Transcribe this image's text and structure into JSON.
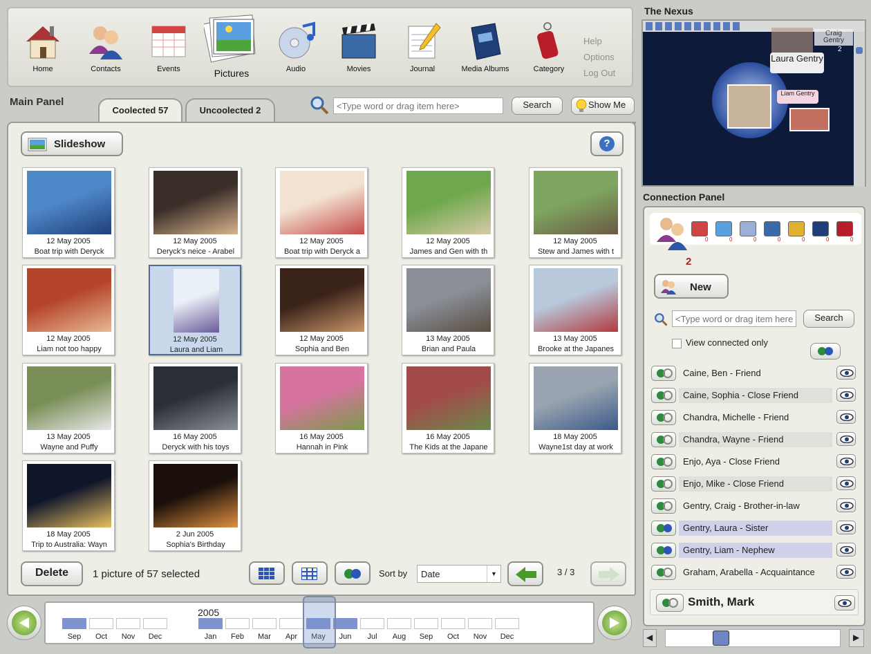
{
  "toolbar": {
    "items": [
      {
        "label": "Home",
        "icon": "home-icon"
      },
      {
        "label": "Contacts",
        "icon": "contacts-icon"
      },
      {
        "label": "Events",
        "icon": "calendar-icon"
      },
      {
        "label": "Pictures",
        "icon": "pictures-icon"
      },
      {
        "label": "Audio",
        "icon": "cd-icon"
      },
      {
        "label": "Movies",
        "icon": "clapperboard-icon"
      },
      {
        "label": "Journal",
        "icon": "notepad-icon"
      },
      {
        "label": "Media Albums",
        "icon": "book-icon"
      },
      {
        "label": "Category",
        "icon": "tag-icon"
      }
    ],
    "side_links": [
      "Help",
      "Options",
      "Log Out"
    ]
  },
  "main_panel": {
    "title": "Main Panel",
    "tabs": [
      "Coolected 57",
      "Uncoolected 2"
    ],
    "search_placeholder": "<Type word or drag item here>",
    "search_label": "Search",
    "show_me_label": "Show  Me",
    "slideshow_label": "Slideshow",
    "help_label": "?",
    "photos": [
      {
        "date": "12 May 2005",
        "caption": "Boat trip with Deryck"
      },
      {
        "date": "12 May 2005",
        "caption": "Deryck's neice - Arabel"
      },
      {
        "date": "12 May 2005",
        "caption": "Boat trip with Deryck a"
      },
      {
        "date": "12 May 2005",
        "caption": "James and Gen with th"
      },
      {
        "date": "12 May 2005",
        "caption": "Stew and James with t"
      },
      {
        "date": "12 May 2005",
        "caption": "Liam not too happy"
      },
      {
        "date": "12 May 2005",
        "caption": "Laura and Liam"
      },
      {
        "date": "12 May 2005",
        "caption": "Sophia and Ben"
      },
      {
        "date": "13 May 2005",
        "caption": "Brian and Paula"
      },
      {
        "date": "13 May 2005",
        "caption": "Brooke at the Japanes"
      },
      {
        "date": "13 May 2005",
        "caption": "Wayne and Puffy"
      },
      {
        "date": "16 May 2005",
        "caption": "Deryck with his toys"
      },
      {
        "date": "16 May 2005",
        "caption": "Hannah in Pink"
      },
      {
        "date": "16 May 2005",
        "caption": "The Kids at the Japane"
      },
      {
        "date": "18 May 2005",
        "caption": "Wayne1st day at work"
      },
      {
        "date": "18 May 2005",
        "caption": "Trip to Australia: Wayn"
      },
      {
        "date": "2 Jun 2005",
        "caption": "Sophia's Birthday"
      }
    ],
    "delete_label": "Delete",
    "selection_status": "1 picture of 57 selected",
    "sort_by_label": "Sort by",
    "sort_value": "Date",
    "page_indicator": "3 / 3"
  },
  "nexus": {
    "title": "The Nexus",
    "labels": [
      "Laura Gentry",
      "Liam Gentry",
      "Craig Gentry",
      "2"
    ]
  },
  "connection_panel": {
    "title": "Connection Panel",
    "count": "2",
    "tab_counts": [
      "0",
      "0",
      "0",
      "0",
      "0",
      "0",
      "0"
    ],
    "new_label": "New",
    "search_placeholder": "<Type word or drag item here>",
    "search_label": "Search",
    "view_connected_label": "View connected only",
    "connections": [
      {
        "name": "Caine, Ben - Friend",
        "hl": "none"
      },
      {
        "name": "Caine, Sophia - Close Friend",
        "hl": "grey"
      },
      {
        "name": "Chandra, Michelle - Friend",
        "hl": "none"
      },
      {
        "name": "Chandra, Wayne - Friend",
        "hl": "grey"
      },
      {
        "name": "Enjo, Aya - Close Friend",
        "hl": "none"
      },
      {
        "name": "Enjo, Mike - Close Friend",
        "hl": "grey"
      },
      {
        "name": "Gentry, Craig - Brother-in-law",
        "hl": "none"
      },
      {
        "name": "Gentry, Laura - Sister",
        "hl": "blue"
      },
      {
        "name": "Gentry, Liam - Nephew",
        "hl": "blue"
      },
      {
        "name": "Graham, Arabella - Acquaintance",
        "hl": "none"
      }
    ],
    "current_contact": "Smith, Mark"
  },
  "timeline": {
    "year": "2005",
    "prev_months": [
      "Sep",
      "Oct",
      "Nov",
      "Dec"
    ],
    "months": [
      "Jan",
      "Feb",
      "Mar",
      "Apr",
      "May",
      "Jun",
      "Jul",
      "Aug",
      "Sep",
      "Oct",
      "Nov",
      "Dec"
    ],
    "selected": "May"
  },
  "colors": {
    "accent": "#7f93cf",
    "nexus_bg": "#0e1a3a",
    "selected": "#c8d8ea"
  }
}
